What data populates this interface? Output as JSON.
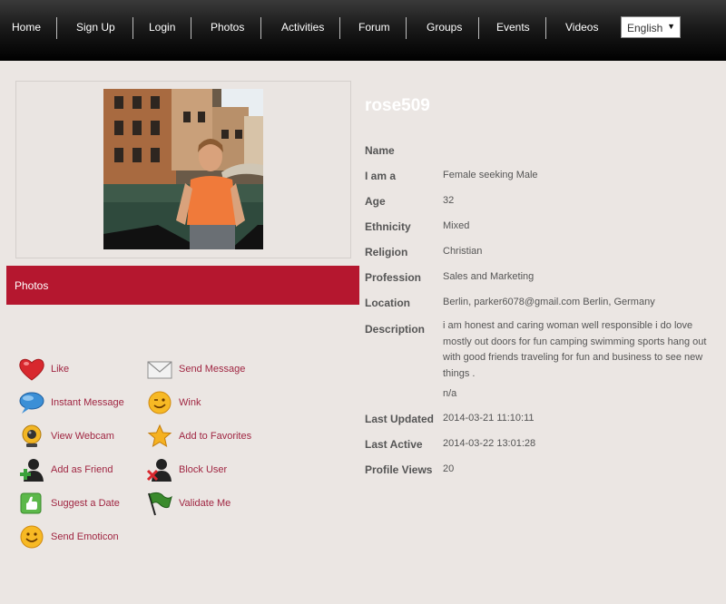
{
  "nav": {
    "items": [
      "Home",
      "Sign Up",
      "Login",
      "Photos",
      "Activities",
      "Forum",
      "Groups",
      "Events",
      "Videos"
    ],
    "language": "English"
  },
  "photos_bar": {
    "label": "Photos"
  },
  "actions": [
    {
      "label": "Like",
      "icon": "heart-icon"
    },
    {
      "label": "Send Message",
      "icon": "envelope-icon"
    },
    {
      "label": "Instant Message",
      "icon": "chat-bubble-icon"
    },
    {
      "label": "Wink",
      "icon": "wink-smiley-icon"
    },
    {
      "label": "View Webcam",
      "icon": "webcam-icon"
    },
    {
      "label": "Add to Favorites",
      "icon": "star-icon"
    },
    {
      "label": "Add as Friend",
      "icon": "add-user-icon"
    },
    {
      "label": "Block User",
      "icon": "block-user-icon"
    },
    {
      "label": "Suggest a Date",
      "icon": "thumbs-up-icon"
    },
    {
      "label": "Validate Me",
      "icon": "flag-icon"
    },
    {
      "label": "Send Emoticon",
      "icon": "smiley-icon"
    }
  ],
  "profile": {
    "username": "rose509",
    "fields": [
      {
        "label": "Name",
        "value": ""
      },
      {
        "label": "I am a",
        "value": "Female seeking Male"
      },
      {
        "label": "Age",
        "value": "32"
      },
      {
        "label": "Ethnicity",
        "value": "Mixed"
      },
      {
        "label": "Religion",
        "value": "Christian"
      },
      {
        "label": "Profession",
        "value": "Sales and Marketing"
      },
      {
        "label": "Location",
        "value": "Berlin, parker6078@gmail.com Berlin, Germany"
      }
    ],
    "description_label": "Description",
    "description": "i am honest and caring woman well responsible i do love mostly out doors for fun camping swimming sports hang out with good friends traveling for fun and business to see new things .",
    "description_extra": "n/a",
    "stats": [
      {
        "label": "Last Updated",
        "value": "2014-03-21 11:10:11"
      },
      {
        "label": "Last Active",
        "value": "2014-03-22 13:01:28"
      },
      {
        "label": "Profile Views",
        "value": "20"
      }
    ]
  }
}
